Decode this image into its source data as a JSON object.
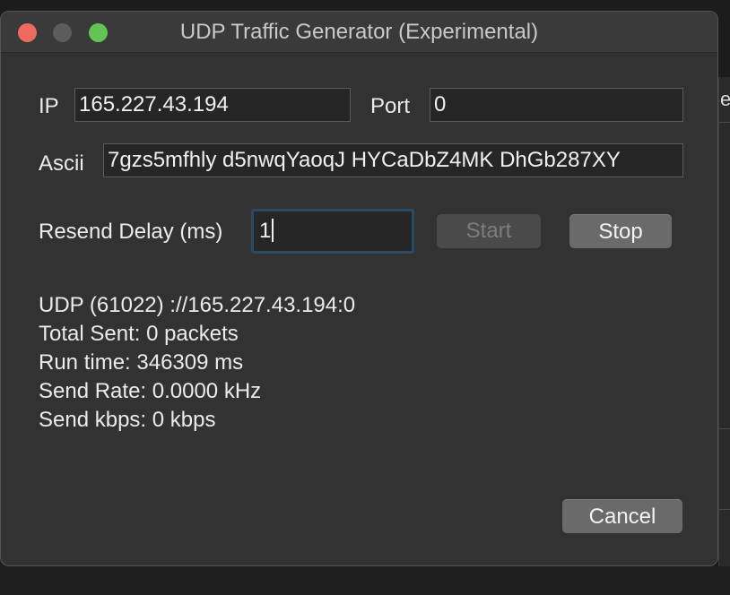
{
  "window": {
    "title": "UDP Traffic Generator (Experimental)"
  },
  "background": {
    "partial_char": "e"
  },
  "form": {
    "ip_label": "IP",
    "ip_value": "165.227.43.194",
    "port_label": "Port",
    "port_value": "0",
    "ascii_label": "Ascii",
    "ascii_value": "7gzs5mfhly d5nwqYaoqJ HYCaDbZ4MK DhGb287XY",
    "delay_label": "Resend Delay (ms)",
    "delay_value": "1"
  },
  "buttons": {
    "start_label": "Start",
    "stop_label": "Stop",
    "cancel_label": "Cancel"
  },
  "status": {
    "lines": [
      "UDP (61022) ://165.227.43.194:0",
      "Total Sent: 0 packets",
      "Run time: 346309 ms",
      "Send Rate: 0.0000 kHz",
      "Send kbps: 0 kbps"
    ]
  },
  "colors": {
    "close": "#ed6a5e",
    "minimize": "#5c5c5c",
    "maximize": "#62c454",
    "focus_ring": "#2b4a64"
  }
}
